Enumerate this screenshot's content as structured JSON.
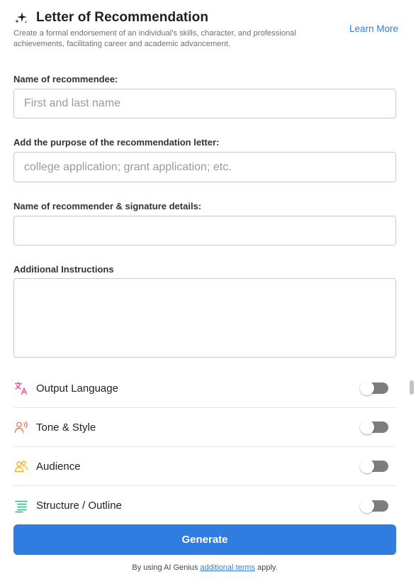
{
  "header": {
    "title": "Letter of Recommendation",
    "subtitle": "Create a formal endorsement of an individual's skills, character, and professional achievements, facilitating career and academic advancement.",
    "learn_more": "Learn More"
  },
  "form": {
    "recommendee": {
      "label": "Name of recommendee:",
      "placeholder": "First and last name",
      "value": ""
    },
    "purpose": {
      "label": "Add the purpose of the recommendation letter:",
      "placeholder": "college application; grant application; etc.",
      "value": ""
    },
    "recommender": {
      "label": "Name of recommender & signature details:",
      "placeholder": "",
      "value": ""
    },
    "instructions": {
      "label": "Additional Instructions",
      "placeholder": "",
      "value": ""
    }
  },
  "options": [
    {
      "label": "Output Language",
      "icon": "translate-icon",
      "color": "#e0529c",
      "enabled": false
    },
    {
      "label": "Tone & Style",
      "icon": "speaking-person-icon",
      "color": "#f07a5a",
      "enabled": false
    },
    {
      "label": "Audience",
      "icon": "people-group-icon",
      "color": "#f2b51c",
      "enabled": false
    },
    {
      "label": "Structure / Outline",
      "icon": "outline-list-icon",
      "color": "#2fb37a",
      "enabled": false
    }
  ],
  "generate_label": "Generate",
  "terms": {
    "prefix": "By using AI Genius ",
    "link": "additional terms",
    "suffix": " apply."
  },
  "colors": {
    "accent": "#2f7de1",
    "toggle_off": "#7d7d7d"
  }
}
